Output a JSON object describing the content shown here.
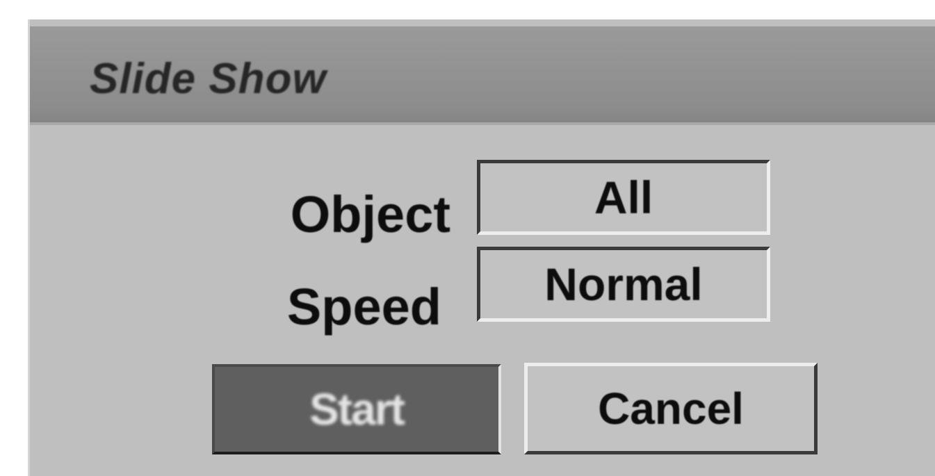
{
  "dialog": {
    "title": "Slide Show",
    "fields": {
      "object": {
        "label": "Object",
        "value": "All"
      },
      "speed": {
        "label": "Speed",
        "value": "Normal"
      }
    },
    "buttons": {
      "start_label": "Start",
      "cancel_label": "Cancel",
      "selected": "Start"
    }
  },
  "colors": {
    "titlebar": "#8f8f8f",
    "panel": "#bfbfbf",
    "selected_button": "#5f5f5f"
  }
}
